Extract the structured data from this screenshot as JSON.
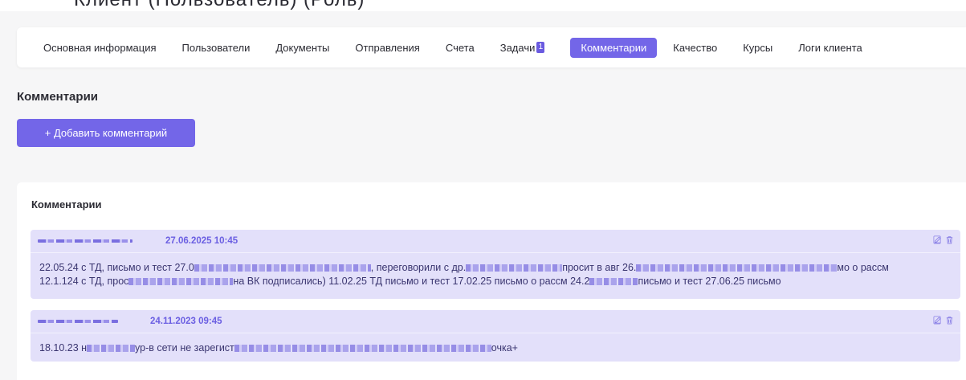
{
  "page_header": {
    "title_cut": "Клиент  (Пользователь)  (Роль)"
  },
  "tabs": [
    {
      "label": "Основная информация",
      "name": "tab-main-info"
    },
    {
      "label": "Пользователи",
      "name": "tab-users"
    },
    {
      "label": "Документы",
      "name": "tab-documents"
    },
    {
      "label": "Отправления",
      "name": "tab-shipments"
    },
    {
      "label": "Счета",
      "name": "tab-invoices"
    },
    {
      "label": "Задачи",
      "name": "tab-tasks",
      "badge": "1"
    },
    {
      "label": "Комментарии",
      "name": "tab-comments",
      "active": true
    },
    {
      "label": "Качество",
      "name": "tab-quality"
    },
    {
      "label": "Курсы",
      "name": "tab-courses"
    },
    {
      "label": "Логи клиента",
      "name": "tab-client-logs"
    }
  ],
  "section": {
    "title": "Комментарии",
    "add_button_label": "+ Добавить комментарий"
  },
  "comments_card": {
    "title": "Комментарии",
    "comments": [
      {
        "date": "27.06.2025 10:45",
        "lines": [
          [
            "22.05.24 с ТД, письмо и тест 27.0",
            "",
            ", переговорили с др.",
            "",
            "просит в авг 26.",
            "",
            "мо о рассм"
          ],
          [
            "12.1.124 с ТД, прос",
            "",
            "на ВК подписались) 11.02.25 ТД письмо и тест 17.02.25 письмо о рассм 24.2",
            "",
            "письмо и тест 27.06.25 письмо"
          ]
        ]
      },
      {
        "date": "24.11.2023 09:45",
        "lines": [
          [
            "18.10.23 н",
            "",
            "ур-в сети не зарегист",
            "",
            "очка+"
          ]
        ]
      }
    ]
  },
  "icons": {
    "edit": "edit-icon",
    "delete": "trash-icon"
  },
  "colors": {
    "accent": "#7366e8",
    "comment_bg": "#e3e0fa",
    "date": "#6b5fe2",
    "page_bg": "#f6f6f7"
  }
}
